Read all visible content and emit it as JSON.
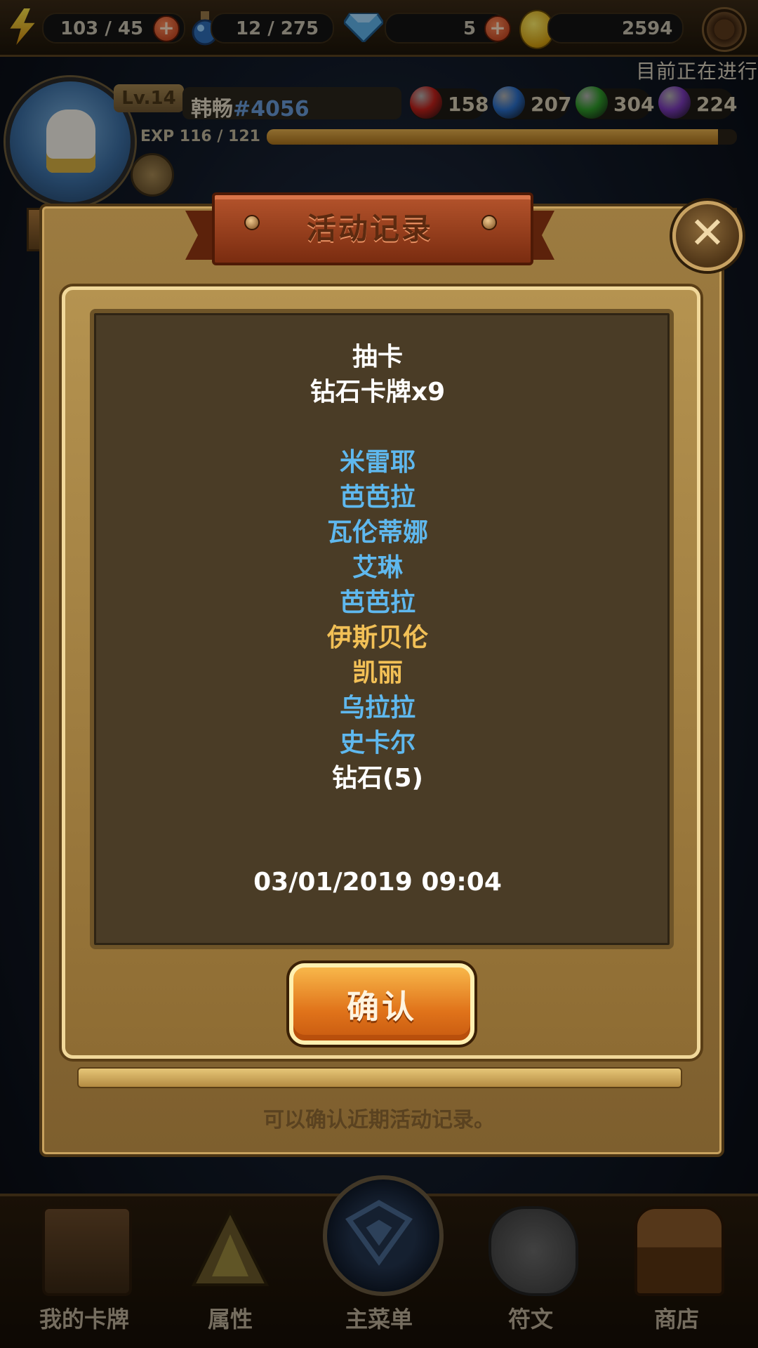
{
  "topbar": {
    "energy": "103 / 45",
    "potion": "12 / 275",
    "gems": "5",
    "gold": "2594",
    "ticker": "目前正在进行"
  },
  "player": {
    "level": "Lv.14",
    "name": "韩畅",
    "tag": "#4056",
    "exp_label": "EXP  116 / 121",
    "exp_progress": 0.96,
    "orbs": [
      {
        "value": "158",
        "color": "#c0201a"
      },
      {
        "value": "207",
        "color": "#2a6ec8"
      },
      {
        "value": "304",
        "color": "#2f9a2a"
      },
      {
        "value": "224",
        "color": "#7a3ab8"
      }
    ]
  },
  "dialog": {
    "title": "活动记录",
    "close": "✕",
    "confirm": "确认",
    "hint": "可以确认近期活动记录。",
    "record": {
      "type": "抽卡",
      "summary": "钻石卡牌x9",
      "cards": [
        {
          "name": "米雷耶",
          "rarity": "blue"
        },
        {
          "name": "芭芭拉",
          "rarity": "blue"
        },
        {
          "name": "瓦伦蒂娜",
          "rarity": "blue"
        },
        {
          "name": "艾琳",
          "rarity": "blue"
        },
        {
          "name": "芭芭拉",
          "rarity": "blue"
        },
        {
          "name": "伊斯贝伦",
          "rarity": "gold"
        },
        {
          "name": "凯丽",
          "rarity": "gold"
        },
        {
          "name": "乌拉拉",
          "rarity": "blue"
        },
        {
          "name": "史卡尔",
          "rarity": "blue"
        }
      ],
      "bonus": "钻石(5)",
      "timestamp": "03/01/2019 09:04"
    }
  },
  "nav": [
    {
      "label": "我的卡牌",
      "icon": "card-deck-icon"
    },
    {
      "label": "属性",
      "icon": "pyramid-icon"
    },
    {
      "label": "主菜单",
      "icon": "emblem-icon"
    },
    {
      "label": "符文",
      "icon": "rune-stone-icon"
    },
    {
      "label": "商店",
      "icon": "treasure-chest-icon"
    }
  ]
}
